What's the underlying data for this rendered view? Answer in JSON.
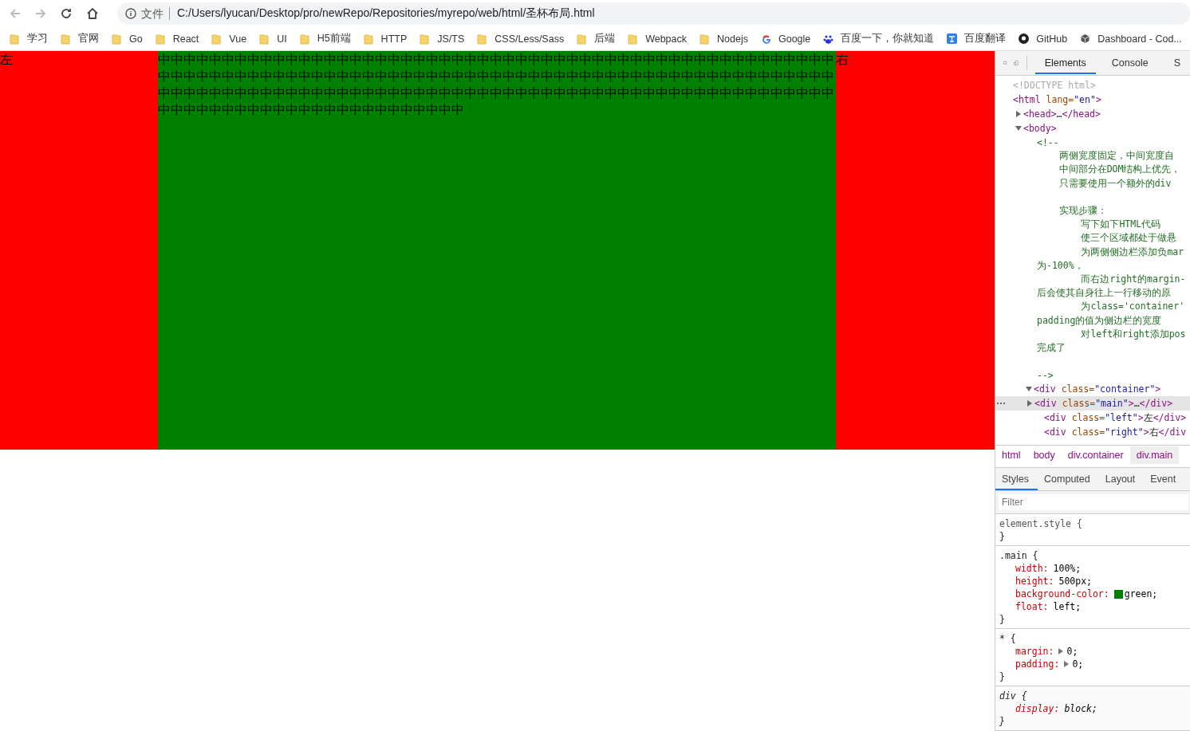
{
  "toolbar": {
    "file_label": "文件",
    "url": "C:/Users/lyucan/Desktop/pro/newRepo/Repositories/myrepo/web/html/圣杯布局.html"
  },
  "bookmarks": [
    {
      "label": "学习",
      "kind": "folder"
    },
    {
      "label": "官网",
      "kind": "folder"
    },
    {
      "label": "Go",
      "kind": "folder"
    },
    {
      "label": "React",
      "kind": "folder"
    },
    {
      "label": "Vue",
      "kind": "folder"
    },
    {
      "label": "UI",
      "kind": "folder"
    },
    {
      "label": "H5前端",
      "kind": "folder"
    },
    {
      "label": "HTTP",
      "kind": "folder"
    },
    {
      "label": "JS/TS",
      "kind": "folder"
    },
    {
      "label": "CSS/Less/Sass",
      "kind": "folder"
    },
    {
      "label": "后端",
      "kind": "folder"
    },
    {
      "label": "Webpack",
      "kind": "folder"
    },
    {
      "label": "Nodejs",
      "kind": "folder"
    },
    {
      "label": "Google",
      "kind": "google"
    },
    {
      "label": "百度一下，你就知道",
      "kind": "baidu"
    },
    {
      "label": "百度翻译",
      "kind": "translate"
    },
    {
      "label": "GitHub",
      "kind": "github"
    },
    {
      "label": "Dashboard - Cod...",
      "kind": "cube"
    }
  ],
  "page": {
    "left_text": "左",
    "main_text": "中中中中中中中中中中中中中中中中中中中中中中中中中中中中中中中中中中中中中中中中中中中中中中中中中中中中中中中中中中中中中中中中中中中中中中中中中中中中中中中中中中中中中中中中中中中中中中中中中中中中中中中中中中中中中中中中中中中中中中中中中中中中中中中中中中中中中中中中中中中中中中中中中中中中中中中中中中中中中中中中中中中中中中中中中中中中中中中中中中中中中中中",
    "right_text": "右"
  },
  "devtools": {
    "tabs": [
      {
        "label": "Elements",
        "selected": true
      },
      {
        "label": "Console",
        "selected": false
      },
      {
        "label": "S",
        "selected": false
      }
    ],
    "tree": [
      {
        "markup": "<!DOCTYPE html>",
        "kind": "doctype"
      },
      {
        "markup": "<html lang=\"en\">",
        "children": [
          {
            "markup": "<head>…</head>",
            "expanded": false
          },
          {
            "markup": "<body>",
            "expanded": true,
            "children": [
              {
                "kind": "comment",
                "lines": [
                  {
                    "text": "<!--"
                  },
                  {
                    "text": "    两侧宽度固定，中间宽度自"
                  },
                  {
                    "text": "    中间部分在DOM结构上优先，"
                  },
                  {
                    "text": "    只需要使用一个额外的div"
                  },
                  {
                    "text": "    实现步骤：",
                    "blank_before": true
                  },
                  {
                    "text": "        写下如下HTML代码"
                  },
                  {
                    "text": "        使三个区域都处于做悬"
                  },
                  {
                    "text": "        为两侧侧边栏添加负mar"
                  },
                  {
                    "text": "为-100%，"
                  },
                  {
                    "text": "        而右边right的margin-"
                  },
                  {
                    "text": "后会使其自身往上一行移动的原"
                  },
                  {
                    "text": "        为class='container'"
                  },
                  {
                    "text": "padding的值为侧边栏的宽度"
                  },
                  {
                    "text": "        对left和right添加pos"
                  },
                  {
                    "text": "完成了"
                  },
                  {
                    "text": "-->",
                    "blank_before": true
                  }
                ]
              },
              {
                "markup": "<div class=\"container\">",
                "expanded": true,
                "children": [
                  {
                    "markup": "<div class=\"main\">…</div>",
                    "expanded": false,
                    "selected": true
                  },
                  {
                    "markup": "<div class=\"left\">左</div>",
                    "selected": false
                  },
                  {
                    "markup": "<div class=\"right\">右</div",
                    "selected": false
                  }
                ]
              }
            ]
          }
        ]
      }
    ],
    "breadcrumbs": [
      {
        "label": "html",
        "selected": false
      },
      {
        "label": "body",
        "selected": false
      },
      {
        "label": "div.container",
        "selected": false
      },
      {
        "label": "div.main",
        "selected": true
      }
    ],
    "style_tabs": [
      {
        "label": "Styles",
        "selected": true
      },
      {
        "label": "Computed",
        "selected": false
      },
      {
        "label": "Layout",
        "selected": false
      },
      {
        "label": "Event",
        "selected": false
      }
    ],
    "filter": {
      "placeholder": "Filter"
    },
    "rules": [
      {
        "selector": "element.style {",
        "kind": "inline",
        "close": "}"
      },
      {
        "selector": ".main {",
        "kind": "author",
        "props": [
          {
            "name": "width:",
            "value": "100%;"
          },
          {
            "name": "height:",
            "value": "500px;"
          },
          {
            "name": "background-color:",
            "value": "green;",
            "color": "#008000"
          },
          {
            "name": "float:",
            "value": "left;"
          }
        ],
        "close": "}"
      },
      {
        "selector": "* {",
        "kind": "author",
        "props": [
          {
            "name": "margin:",
            "value": "0;",
            "expandable": true
          },
          {
            "name": "padding:",
            "value": "0;",
            "expandable": true
          }
        ],
        "close": "}"
      },
      {
        "selector": "div {",
        "kind": "useragent",
        "props": [
          {
            "name": "display:",
            "value": "block;"
          }
        ],
        "close": "}"
      }
    ]
  }
}
